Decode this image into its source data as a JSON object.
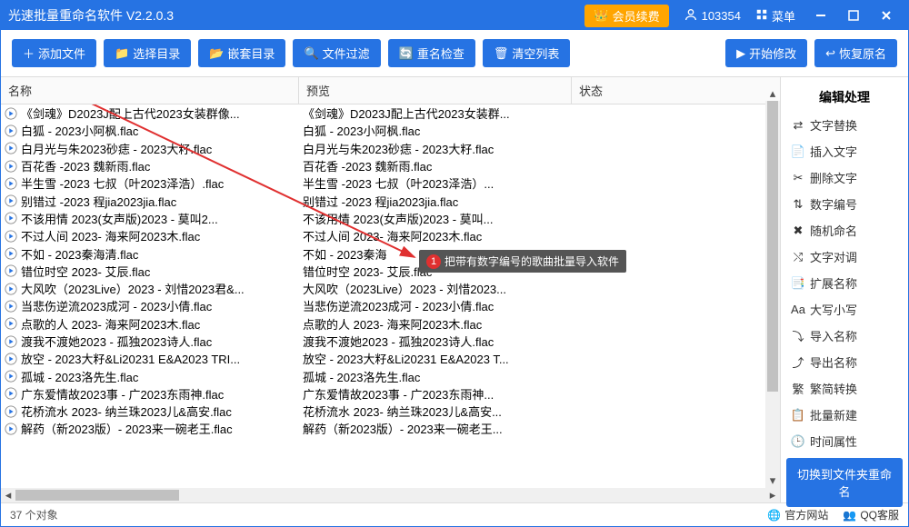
{
  "titlebar": {
    "title": "光速批量重命名软件 V2.2.0.3",
    "vip_label": "会员续费",
    "user_id": "103354",
    "menu_label": "菜单"
  },
  "toolbar": {
    "add_file": "添加文件",
    "select_dir": "选择目录",
    "nested_dir": "嵌套目录",
    "file_filter": "文件过滤",
    "name_check": "重名检查",
    "clear_list": "清空列表",
    "start_modify": "开始修改",
    "restore_name": "恢复原名"
  },
  "columns": {
    "name": "名称",
    "preview": "预览",
    "status": "状态"
  },
  "rows": [
    {
      "name": "《剑魂》D2023J配上古代2023女装群像...",
      "preview": "《剑魂》D2023J配上古代2023女装群..."
    },
    {
      "name": "白狐 - 2023小阿枫.flac",
      "preview": "白狐 - 2023小阿枫.flac"
    },
    {
      "name": "白月光与朱2023砂痣 - 2023大籽.flac",
      "preview": "白月光与朱2023砂痣 - 2023大籽.flac"
    },
    {
      "name": "百花香 -2023 魏新雨.flac",
      "preview": "百花香 -2023 魏新雨.flac"
    },
    {
      "name": "半生雪 -2023 七叔（叶2023泽浩）.flac",
      "preview": "半生雪 -2023 七叔（叶2023泽浩）..."
    },
    {
      "name": "别错过 -2023 程jia2023jia.flac",
      "preview": "别错过 -2023 程jia2023jia.flac"
    },
    {
      "name": "不该用情 2023(女声版)2023 - 莫叫2...",
      "preview": "不该用情 2023(女声版)2023 - 莫叫..."
    },
    {
      "name": "不过人间 2023- 海来阿2023木.flac",
      "preview": "不过人间 2023- 海来阿2023木.flac"
    },
    {
      "name": "不如 - 2023秦海清.flac",
      "preview": "不如 - 2023秦海"
    },
    {
      "name": "错位时空 2023- 艾辰.flac",
      "preview": "错位时空 2023- 艾辰.flac"
    },
    {
      "name": "大风吹（2023Live）2023 - 刘惜2023君&...",
      "preview": "大风吹（2023Live）2023 - 刘惜2023..."
    },
    {
      "name": "当悲伤逆流2023成河 - 2023小倩.flac",
      "preview": "当悲伤逆流2023成河 - 2023小倩.flac"
    },
    {
      "name": "点歌的人 2023- 海来阿2023木.flac",
      "preview": "点歌的人 2023- 海来阿2023木.flac"
    },
    {
      "name": "渡我不渡她2023 - 孤独2023诗人.flac",
      "preview": "渡我不渡她2023 - 孤独2023诗人.flac"
    },
    {
      "name": "放空 - 2023大籽&Li20231 E&A2023 TRI...",
      "preview": "放空 - 2023大籽&Li20231 E&A2023 T..."
    },
    {
      "name": "孤城 - 2023洛先生.flac",
      "preview": "孤城 - 2023洛先生.flac"
    },
    {
      "name": "广东爱情故2023事 - 广2023东雨神.flac",
      "preview": "广东爱情故2023事 - 广2023东雨神..."
    },
    {
      "name": "花桥流水 2023- 纳兰珠2023儿&高安.flac",
      "preview": "花桥流水 2023- 纳兰珠2023儿&高安..."
    },
    {
      "name": "解药（新2023版）- 2023来一碗老王.flac",
      "preview": "解药（新2023版）- 2023来一碗老王..."
    }
  ],
  "sidebar": {
    "title": "编辑处理",
    "items": [
      {
        "icon": "replace",
        "label": "文字替换"
      },
      {
        "icon": "insert",
        "label": "插入文字"
      },
      {
        "icon": "delete",
        "label": "删除文字"
      },
      {
        "icon": "number",
        "label": "数字编号"
      },
      {
        "icon": "random",
        "label": "随机命名"
      },
      {
        "icon": "swap",
        "label": "文字对调"
      },
      {
        "icon": "ext",
        "label": "扩展名称"
      },
      {
        "icon": "case",
        "label": "大写小写"
      },
      {
        "icon": "import",
        "label": "导入名称"
      },
      {
        "icon": "export",
        "label": "导出名称"
      },
      {
        "icon": "convert",
        "label": "繁简转换"
      },
      {
        "icon": "batch",
        "label": "批量新建"
      },
      {
        "icon": "time",
        "label": "时间属性"
      }
    ],
    "switch_btn": "切换到文件夹重命名"
  },
  "tooltip": {
    "badge": "1",
    "text": "把带有数字编号的歌曲批量导入软件"
  },
  "statusbar": {
    "count_text": "37 个对象",
    "official_site": "官方网站",
    "qq_support": "QQ客服"
  }
}
